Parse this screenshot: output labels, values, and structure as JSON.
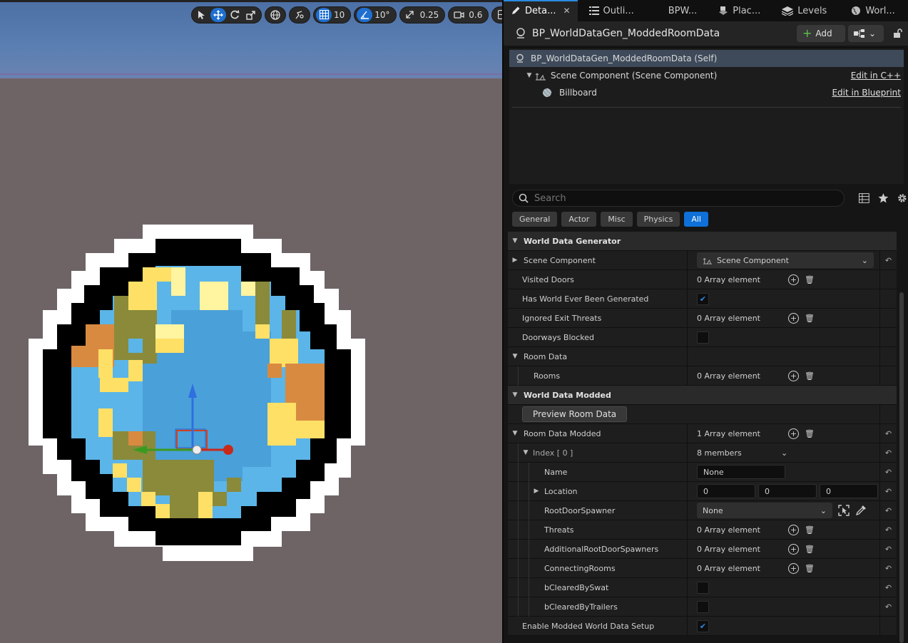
{
  "viewport": {
    "toolbar": {
      "grid_snap": "10",
      "angle_snap": "10°",
      "scale_snap": "0.25",
      "camera_speed": "0.6"
    }
  },
  "tabs": [
    {
      "label": "Deta...",
      "icon": "pencil-icon",
      "active": true,
      "closable": true
    },
    {
      "label": "Outli...",
      "icon": "outliner-icon"
    },
    {
      "label": "BPW...",
      "icon": ""
    },
    {
      "label": "Plac...",
      "icon": "place-actors-icon"
    },
    {
      "label": "Levels",
      "icon": "levels-icon"
    },
    {
      "label": "Worl...",
      "icon": "world-icon"
    }
  ],
  "header": {
    "title": "BP_WorldDataGen_ModdedRoomData",
    "add_label": "Add"
  },
  "components": {
    "self": "BP_WorldDataGen_ModdedRoomData (Self)",
    "scene": "Scene Component (Scene Component)",
    "scene_link": "Edit in C++",
    "billboard": "Billboard",
    "billboard_link": "Edit in Blueprint"
  },
  "search": {
    "placeholder": "Search"
  },
  "filters": [
    "General",
    "Actor",
    "Misc",
    "Physics",
    "All"
  ],
  "props": {
    "cat_world_data_generator": "World Data Generator",
    "scene_component": "Scene Component",
    "scene_component_value": "Scene Component",
    "visited_doors": "Visited Doors",
    "visited_doors_value": "0 Array element",
    "has_world_generated": "Has World Ever Been Generated",
    "ignored_exit_threats": "Ignored Exit Threats",
    "ignored_exit_threats_value": "0 Array element",
    "doorways_blocked": "Doorways Blocked",
    "room_data": "Room Data",
    "rooms": "Rooms",
    "rooms_value": "0 Array element",
    "cat_world_data_modded": "World Data Modded",
    "preview_button": "Preview Room Data",
    "room_data_modded": "Room Data Modded",
    "room_data_modded_value": "1 Array element",
    "index0": "Index [ 0 ]",
    "index0_value": "8 members",
    "name": "Name",
    "name_value": "None",
    "location": "Location",
    "location_x": "0",
    "location_y": "0",
    "location_z": "0",
    "root_door_spawner": "RootDoorSpawner",
    "root_door_spawner_value": "None",
    "threats": "Threats",
    "threats_value": "0 Array element",
    "additional_root": "AdditionalRootDoorSpawners",
    "additional_root_value": "0 Array element",
    "connecting_rooms": "ConnectingRooms",
    "connecting_rooms_value": "0 Array element",
    "b_cleared_swat": "bClearedBySwat",
    "b_cleared_trailers": "bClearedByTrailers",
    "enable_modded": "Enable Modded World Data Setup"
  }
}
